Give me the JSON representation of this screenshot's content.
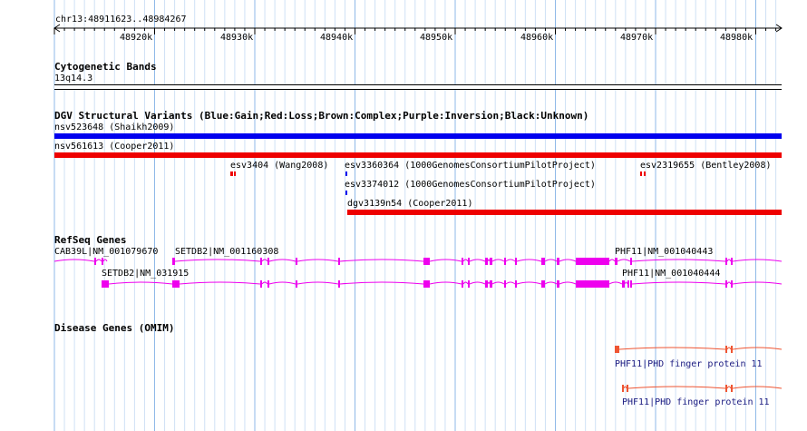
{
  "ruler": {
    "coords": "chr13:48911623..48984267",
    "ticks": [
      "48920k",
      "48930k",
      "48940k",
      "48950k",
      "48960k",
      "48970k",
      "48980k"
    ]
  },
  "cytoband": {
    "title": "Cytogenetic Bands",
    "band": "13q14.3"
  },
  "dgv": {
    "title": "DGV Structural Variants (Blue:Gain;Red:Loss;Brown:Complex;Purple:Inversion;Black:Unknown)",
    "variants": [
      {
        "id": "nsv523648",
        "label": "nsv523648 (Shaikh2009)",
        "color": "#0000ee",
        "type": "Gain"
      },
      {
        "id": "nsv561613",
        "label": "nsv561613 (Cooper2011)",
        "color": "#ee0000",
        "type": "Loss"
      },
      {
        "id": "esv3404",
        "label": "esv3404 (Wang2008)",
        "color": "#ee0000",
        "type": "Loss"
      },
      {
        "id": "esv3360364",
        "label": "esv3360364 (1000GenomesConsortiumPilotProject)",
        "color": "#0000ee",
        "type": "Gain"
      },
      {
        "id": "esv2319655",
        "label": "esv2319655 (Bentley2008)",
        "color": "#ee0000",
        "type": "Loss"
      },
      {
        "id": "esv3374012",
        "label": "esv3374012 (1000GenomesConsortiumPilotProject)",
        "color": "#0000ee",
        "type": "Gain"
      },
      {
        "id": "dgv3139n54",
        "label": "dgv3139n54 (Cooper2011)",
        "color": "#ee0000",
        "type": "Loss"
      }
    ]
  },
  "refseq": {
    "title": "RefSeq Genes",
    "color": "#ee00ee",
    "genes": [
      {
        "label": "CAB39L|NM_001079670"
      },
      {
        "label": "SETDB2|NM_001160308"
      },
      {
        "label": "PHF11|NM_001040443"
      },
      {
        "label": "SETDB2|NM_031915"
      },
      {
        "label": "PHF11|NM_001040444"
      }
    ]
  },
  "omim": {
    "title": "Disease Genes (OMIM)",
    "color": "#ee5533",
    "genes": [
      {
        "label": "PHF11|PHD finger protein 11"
      },
      {
        "label": "PHF11|PHD finger protein 11"
      }
    ]
  }
}
